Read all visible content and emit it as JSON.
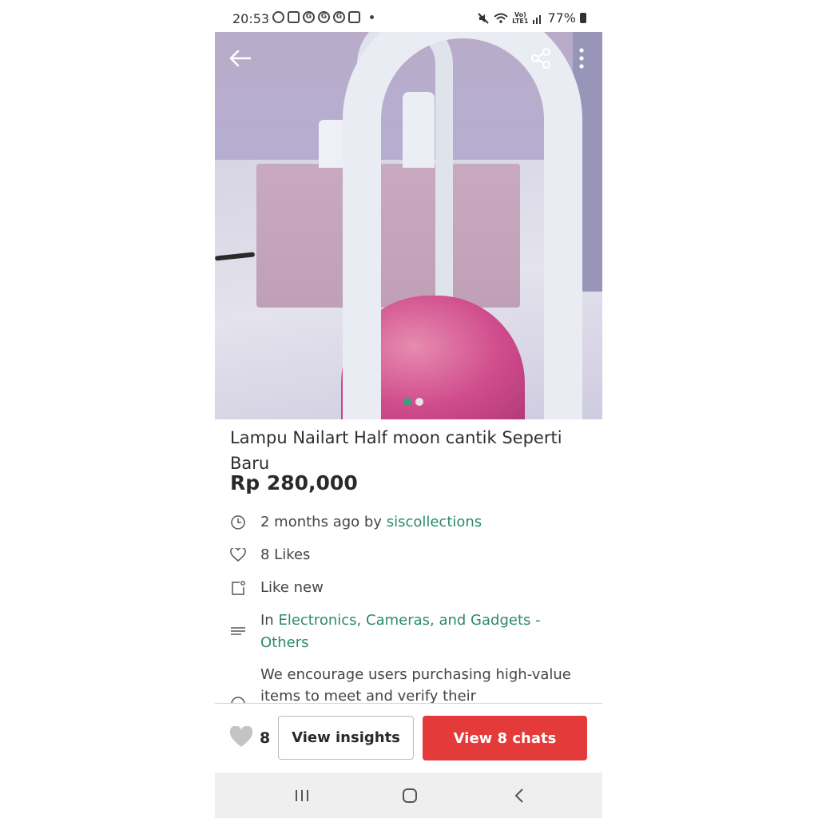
{
  "status_bar": {
    "time": "20:53",
    "battery": "77%",
    "notification_icons": [
      "whatsapp-icon",
      "shopee-icon",
      "google-icon",
      "google-icon",
      "google-icon",
      "gallery-icon"
    ],
    "status_icons": [
      "mute-icon",
      "wifi-icon",
      "volte-icon",
      "signal-icon",
      "battery-icon"
    ],
    "volte_label_top": "Vo)",
    "volte_label_bottom": "LTE1"
  },
  "hero": {
    "image_alt_icon": "product-photo",
    "carousel_count": 2,
    "carousel_active": 0,
    "actions": [
      "back-icon",
      "share-icon",
      "more-icon"
    ]
  },
  "listing": {
    "title": "Lampu Nailart Half moon cantik Seperti Baru",
    "price": "Rp 280,000",
    "posted_prefix": "2 months ago by ",
    "seller": "siscollections",
    "likes": "8 Likes",
    "condition": "Like new",
    "category_prefix": "In ",
    "category": "Electronics, Cameras, and Gadgets - Others",
    "notice": "We encourage users purchasing high-value items to meet and verify their"
  },
  "action_bar": {
    "like_count": "8",
    "insights_label": "View insights",
    "chats_label": "View 8 chats"
  },
  "colors": {
    "accent_green": "#2c8a6a",
    "chats_red": "#e53a3a",
    "carousel_active": "#3aa07a"
  }
}
